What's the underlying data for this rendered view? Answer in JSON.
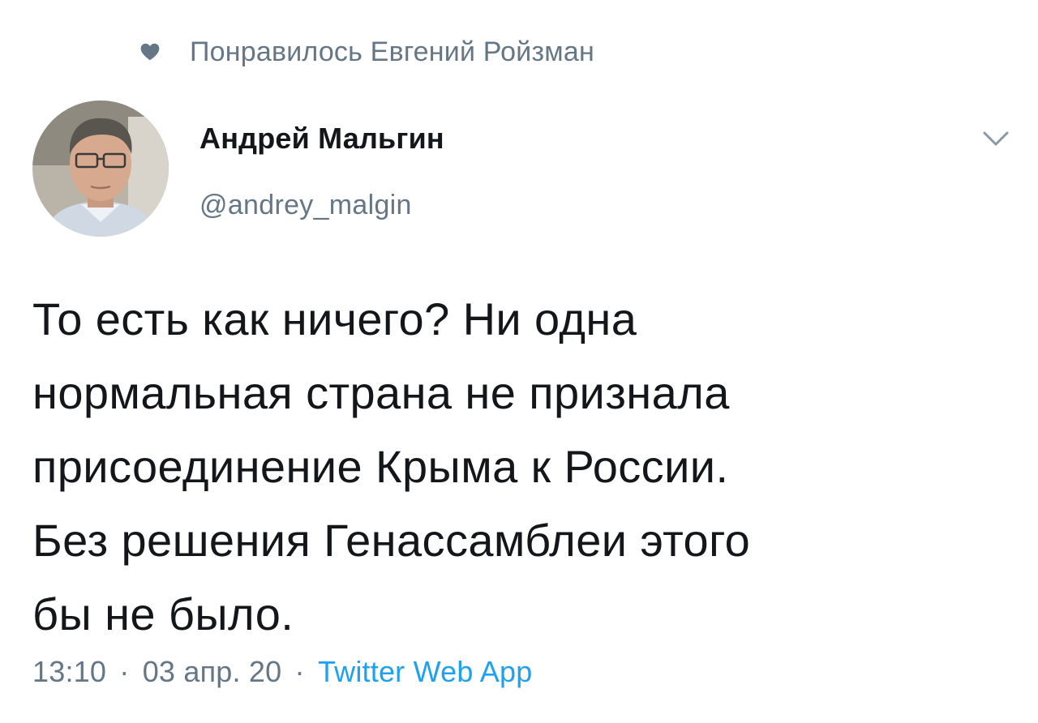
{
  "social_context": {
    "icon": "heart-icon",
    "text": "Понравилось Евгений Ройзман"
  },
  "author": {
    "name": "Андрей Мальгин",
    "handle": "@andrey_malgin",
    "avatar": "avatar-photo"
  },
  "menu": {
    "icon": "chevron-down-icon"
  },
  "tweet": {
    "text": "То есть как ничего? Ни одна\nнормальная страна не признала\nприсоединение Крыма к России.\nБез решения Генассамблеи этого\nбы не было."
  },
  "meta": {
    "time": "13:10",
    "separator": "·",
    "date": "03 апр. 20",
    "source": "Twitter Web App"
  },
  "colors": {
    "text_primary": "#14171a",
    "text_secondary": "#657786",
    "link": "#1da1f2",
    "background": "#ffffff"
  }
}
